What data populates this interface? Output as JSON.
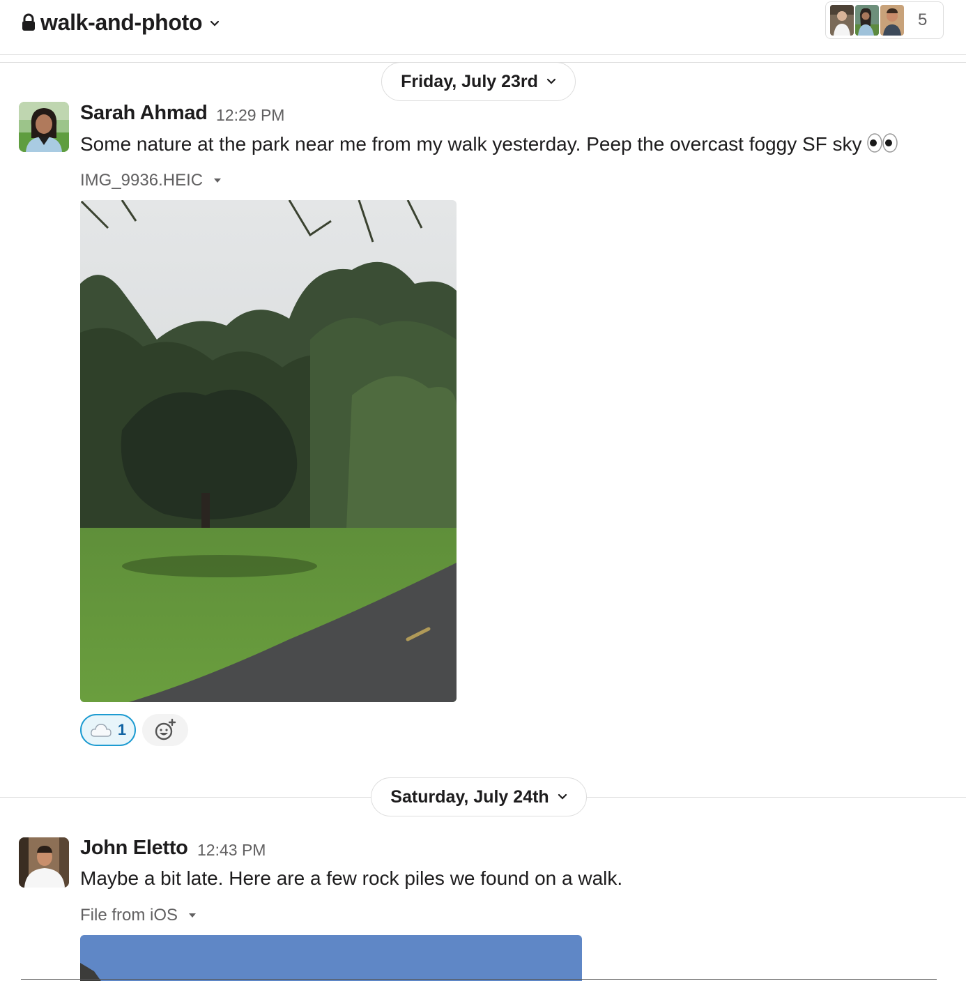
{
  "header": {
    "channel_name": "walk-and-photo",
    "member_count": "5"
  },
  "dividers": [
    {
      "label": "Friday, July 23rd"
    },
    {
      "label": "Saturday, July 24th"
    }
  ],
  "messages": [
    {
      "author": "Sarah Ahmad",
      "time": "12:29 PM",
      "text": "Some nature at the park near me from my walk yesterday. Peep the overcast foggy SF sky",
      "emoji": "eyes-emoji",
      "file_name": "IMG_9936.HEIC",
      "reactions": [
        {
          "icon": "cloud-emoji",
          "count": "1"
        }
      ]
    },
    {
      "author": "John Eletto",
      "time": "12:43 PM",
      "text": "Maybe a bit late. Here are a few rock piles we found on a walk.",
      "file_name": "File from iOS"
    }
  ],
  "colors": {
    "reaction_border": "#1d9bd1",
    "reaction_bg": "#e8f5fa",
    "reaction_count": "#1264a3",
    "muted_text": "#616061",
    "divider": "#dddddd"
  }
}
